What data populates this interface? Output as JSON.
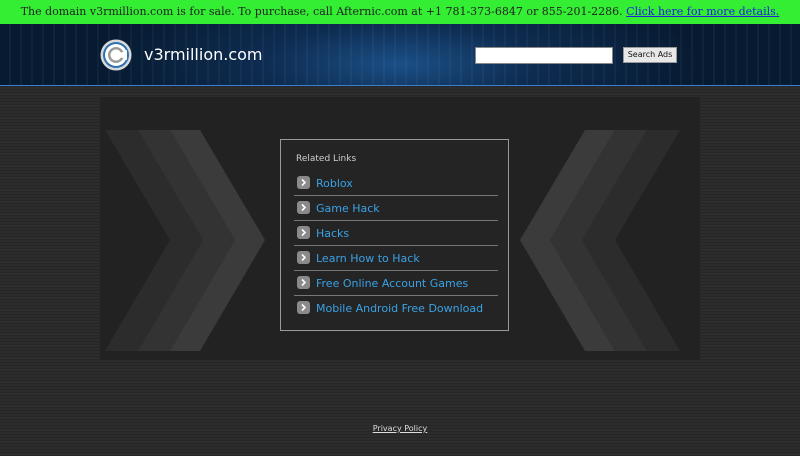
{
  "sale_banner": {
    "text": "The domain v3rmillion.com is for sale. To purchase, call Afternic.com at +1 781-373-6847 or 855-201-2286. ",
    "link": "Click here for more details."
  },
  "header": {
    "site_name": "v3rmillion.com",
    "search": {
      "value": "",
      "placeholder": ""
    },
    "search_button": "Search Ads",
    "logo_icon": "swirl-logo-icon"
  },
  "related_links": {
    "title": "Related Links",
    "items": [
      {
        "label": "Roblox",
        "icon": "chevron-right-icon"
      },
      {
        "label": "Game Hack",
        "icon": "chevron-right-icon"
      },
      {
        "label": "Hacks",
        "icon": "chevron-right-icon"
      },
      {
        "label": "Learn How to Hack",
        "icon": "chevron-right-icon"
      },
      {
        "label": "Free Online Account Games",
        "icon": "chevron-right-icon"
      },
      {
        "label": "Mobile Android Free Download",
        "icon": "chevron-right-icon"
      }
    ]
  },
  "footer": {
    "privacy": "Privacy Policy"
  },
  "colors": {
    "banner_bg": "#33ee33",
    "link_blue": "#3aa2e6",
    "header_border": "#3a7fd0"
  }
}
